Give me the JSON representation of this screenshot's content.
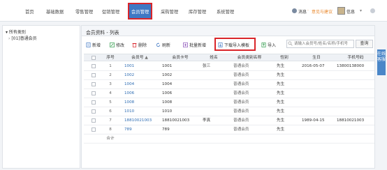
{
  "nav": {
    "items": [
      "首页",
      "基础数据",
      "零售管理",
      "促销管理",
      "会员管理",
      "采购管理",
      "库存管理",
      "系统管理"
    ],
    "active_index": 4
  },
  "topright": {
    "bell_label": "消息",
    "feedback_label": "意见与建议",
    "user_label": "信息"
  },
  "tree": {
    "root_label": "所有类别",
    "child_label": "[01]普通会员"
  },
  "panel": {
    "title": "会员资料 - 列表"
  },
  "toolbar": {
    "new_label": "新增",
    "edit_label": "修改",
    "delete_label": "删除",
    "refresh_label": "刷新",
    "batch_label": "批量新增",
    "download_label": "下载导入模板",
    "import_label": "导入",
    "search_placeholder": "请输入会员号/姓名/名称/手机号",
    "query_label": "查询"
  },
  "table": {
    "headers": {
      "seq": "序号",
      "member_no": "会员号",
      "card_no": "会员卡号",
      "name": "姓名",
      "category": "会员类别名称",
      "gender": "性别",
      "birthday": "生日",
      "phone": "手机号码"
    },
    "rows": [
      {
        "seq": "1",
        "member_no": "1001",
        "card_no": "1001",
        "name": "张三",
        "category": "普通会员",
        "gender": "先生",
        "birthday": "2016-05-07",
        "phone": "13800138000"
      },
      {
        "seq": "2",
        "member_no": "1002",
        "card_no": "1002",
        "name": "",
        "category": "普通会员",
        "gender": "先生",
        "birthday": "",
        "phone": ""
      },
      {
        "seq": "3",
        "member_no": "1004",
        "card_no": "1004",
        "name": "",
        "category": "普通会员",
        "gender": "先生",
        "birthday": "",
        "phone": ""
      },
      {
        "seq": "4",
        "member_no": "1006",
        "card_no": "1006",
        "name": "",
        "category": "普通会员",
        "gender": "先生",
        "birthday": "",
        "phone": ""
      },
      {
        "seq": "5",
        "member_no": "1008",
        "card_no": "1008",
        "name": "",
        "category": "普通会员",
        "gender": "先生",
        "birthday": "",
        "phone": ""
      },
      {
        "seq": "6",
        "member_no": "1010",
        "card_no": "1010",
        "name": "",
        "category": "普通会员",
        "gender": "先生",
        "birthday": "",
        "phone": ""
      },
      {
        "seq": "7",
        "member_no": "18810021003",
        "card_no": "18810021003",
        "name": "李真",
        "category": "普通会员",
        "gender": "先生",
        "birthday": "1989-04-15",
        "phone": "18810021003"
      },
      {
        "seq": "8",
        "member_no": "789",
        "card_no": "789",
        "name": "",
        "category": "普通会员",
        "gender": "先生",
        "birthday": "",
        "phone": ""
      }
    ],
    "total_label": "合计"
  },
  "sidetab": {
    "label": "在线客服"
  },
  "colors": {
    "accent": "#3f78c4",
    "highlight": "#d9252a",
    "link": "#2f6db3"
  }
}
